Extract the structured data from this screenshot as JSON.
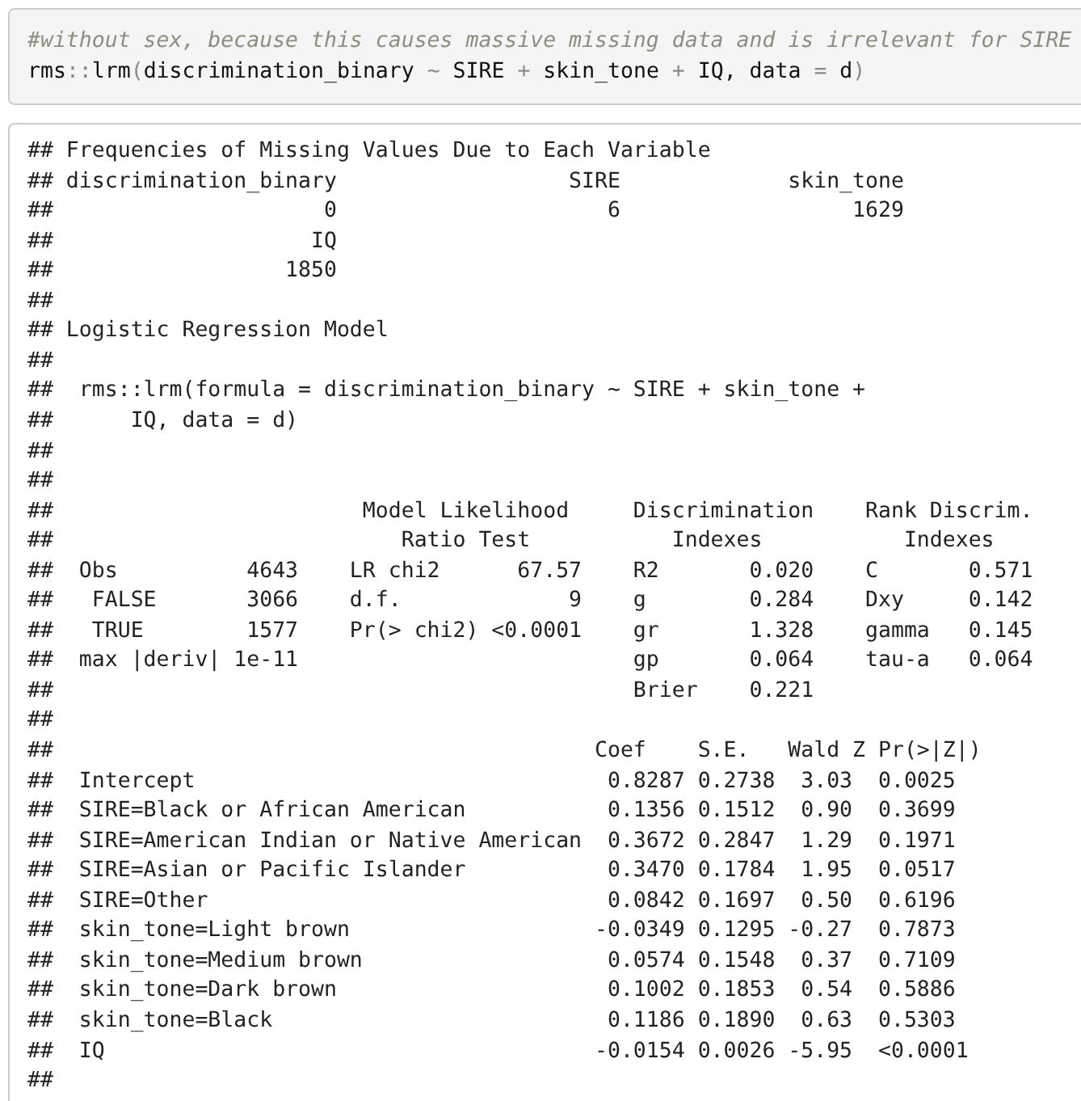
{
  "code_chunk": {
    "comment": "#without sex, because this causes massive missing data and is irrelevant for SIRE",
    "code_tokens": [
      {
        "text": "rms",
        "kind": "name"
      },
      {
        "text": "::",
        "kind": "operator"
      },
      {
        "text": "lrm",
        "kind": "name"
      },
      {
        "text": "(",
        "kind": "operator"
      },
      {
        "text": "discrimination_binary ",
        "kind": "name"
      },
      {
        "text": "~",
        "kind": "operator"
      },
      {
        "text": " SIRE ",
        "kind": "name"
      },
      {
        "text": "+",
        "kind": "operator"
      },
      {
        "text": " skin_tone ",
        "kind": "name"
      },
      {
        "text": "+",
        "kind": "operator"
      },
      {
        "text": " IQ, data ",
        "kind": "name"
      },
      {
        "text": "=",
        "kind": "operator"
      },
      {
        "text": " d",
        "kind": "name"
      },
      {
        "text": ")",
        "kind": "operator"
      }
    ]
  },
  "output": {
    "lines": [
      "## Frequencies of Missing Values Due to Each Variable",
      "## discrimination_binary                  SIRE             skin_tone",
      "##                     0                     6                  1629",
      "##                    IQ",
      "##                  1850",
      "##",
      "## Logistic Regression Model",
      "##",
      "##  rms::lrm(formula = discrimination_binary ~ SIRE + skin_tone + ",
      "##      IQ, data = d)",
      "##",
      "##",
      "##                        Model Likelihood     Discrimination    Rank Discrim.",
      "##                           Ratio Test           Indexes           Indexes",
      "##  Obs          4643    LR chi2      67.57    R2       0.020    C       0.571",
      "##   FALSE       3066    d.f.             9    g        0.284    Dxy     0.142",
      "##   TRUE        1577    Pr(> chi2) <0.0001    gr       1.328    gamma   0.145",
      "##  max |deriv| 1e-11                          gp       0.064    tau-a   0.064",
      "##                                             Brier    0.221",
      "##",
      "##                                          Coef    S.E.   Wald Z Pr(>|Z|)",
      "##  Intercept                                0.8287 0.2738  3.03  0.0025",
      "##  SIRE=Black or African American           0.1356 0.1512  0.90  0.3699",
      "##  SIRE=American Indian or Native American  0.3672 0.2847  1.29  0.1971",
      "##  SIRE=Asian or Pacific Islander           0.3470 0.1784  1.95  0.0517",
      "##  SIRE=Other                               0.0842 0.1697  0.50  0.6196",
      "##  skin_tone=Light brown                   -0.0349 0.1295 -0.27  0.7873",
      "##  skin_tone=Medium brown                   0.0574 0.1548  0.37  0.7109",
      "##  skin_tone=Dark brown                     0.1002 0.1853  0.54  0.5886",
      "##  skin_tone=Black                          0.1186 0.1890  0.63  0.5303",
      "##  IQ                                      -0.0154 0.0026 -5.95  <0.0001",
      "##"
    ]
  }
}
